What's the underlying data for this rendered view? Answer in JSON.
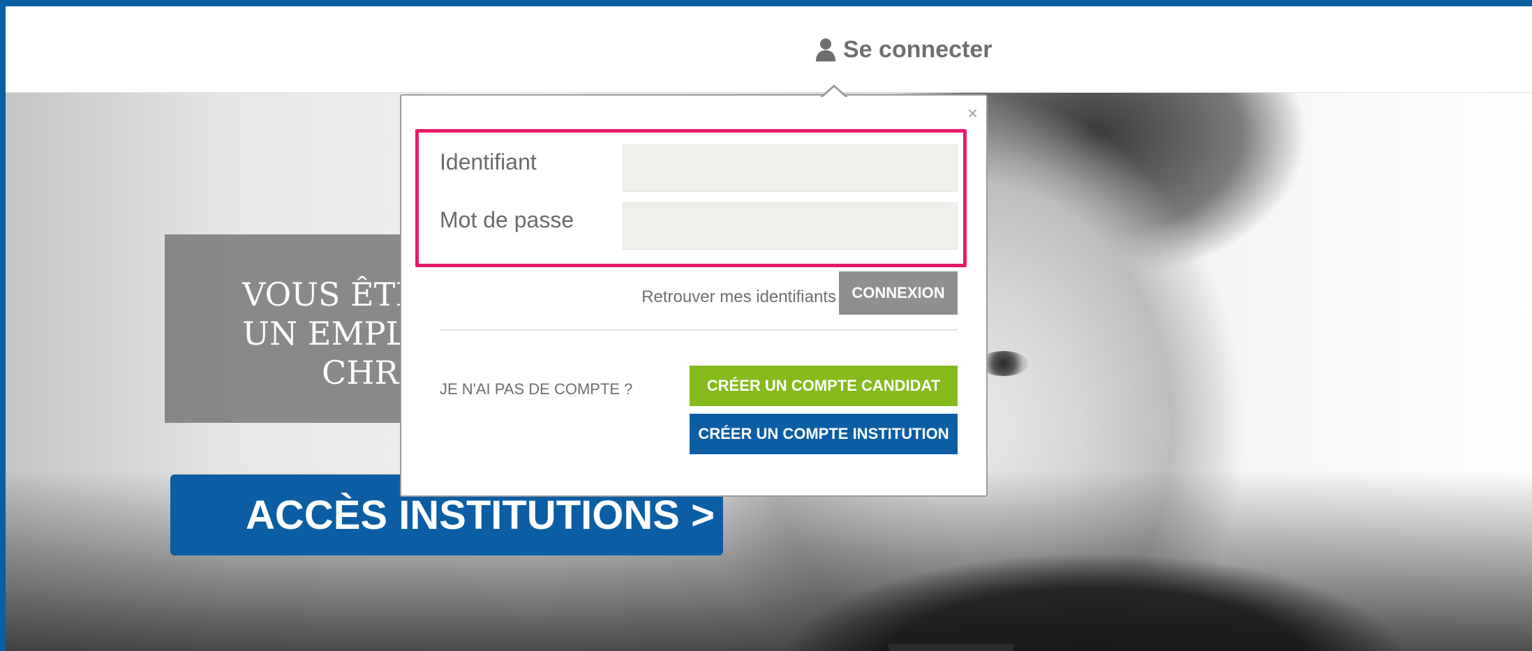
{
  "header": {
    "login_label": "Se connecter",
    "login_icon": "user-icon"
  },
  "hero": {
    "title_lines": [
      "VOUS ÊTES U",
      "UN EMPLOYE",
      "CHR"
    ],
    "access_button": "ACCÈS INSTITUTIONS >"
  },
  "login_popover": {
    "close_label": "×",
    "username_label": "Identifiant",
    "username_value": "",
    "password_label": "Mot de passe",
    "password_value": "",
    "retrieve_link": "Retrouver mes identifiants",
    "submit_button": "CONNEXION",
    "no_account_text": "JE N'AI PAS DE COMPTE ?",
    "create_candidate_button": "CRÉER UN COMPTE CANDIDAT",
    "create_institution_button": "CRÉER UN COMPTE INSTITUTION"
  },
  "colors": {
    "frame": "#0a5fa0",
    "highlight": "#e8196b",
    "candidate_green": "#84bb1b",
    "institution_blue": "#0b5ea3",
    "connexion_gray": "#8f8f8f"
  }
}
